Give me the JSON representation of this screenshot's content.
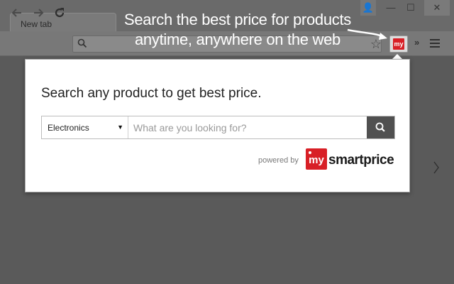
{
  "browser": {
    "tab_label": "New tab",
    "window_buttons": [
      "👤",
      "—",
      "☐",
      "✕"
    ],
    "nav": {
      "back_icon": "back-arrow-icon",
      "forward_icon": "forward-arrow-icon",
      "reload_icon": "reload-icon"
    },
    "overflow_label": "»"
  },
  "caption": {
    "line1": "Search the best price for products",
    "line2": "anytime, anywhere on the web"
  },
  "popup": {
    "title": "Search any product to get best price.",
    "category": "Electronics",
    "search_placeholder": "What are you looking for?",
    "powered_by": "powered by",
    "brand_prefix": "my",
    "brand_name": "smartprice"
  },
  "colors": {
    "brand_red": "#d81f26",
    "search_button": "#505050"
  }
}
